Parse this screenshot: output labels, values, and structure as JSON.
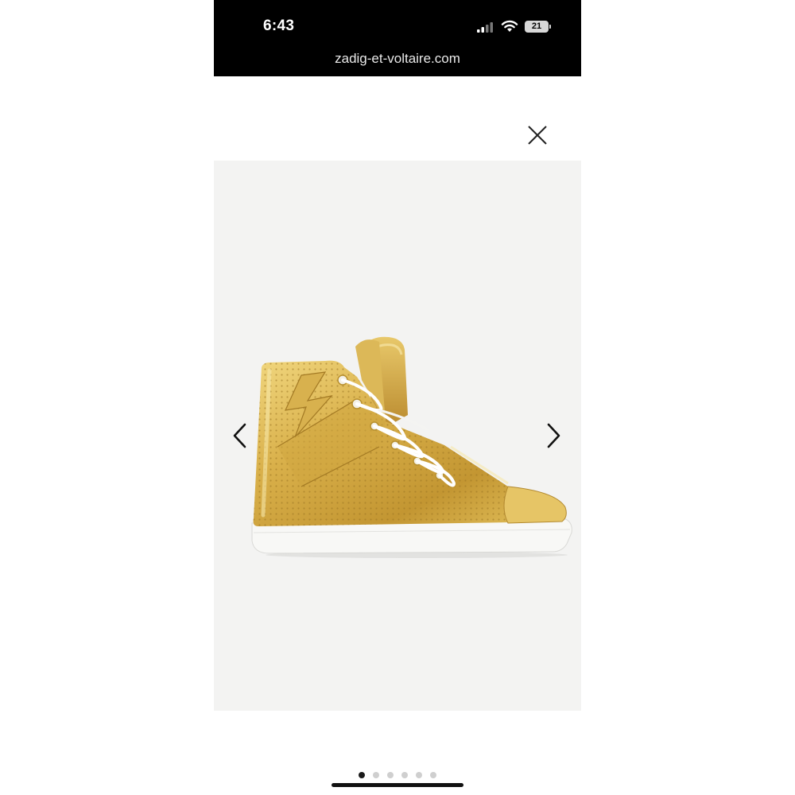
{
  "status_bar": {
    "time": "6:43",
    "battery_level": "21",
    "signal_icon": "cellular-signal-icon",
    "wifi_icon": "wifi-icon",
    "battery_icon": "battery-icon"
  },
  "browser": {
    "url": "zadig-et-voltaire.com"
  },
  "viewer": {
    "close_icon": "close-icon",
    "prev_icon": "chevron-left-icon",
    "next_icon": "chevron-right-icon",
    "image_count": 6,
    "active_index": 0
  },
  "colors": {
    "gallery_background": "#f3f3f2",
    "sneaker_gold": "#d4ae4a",
    "sole_white": "#f7f7f5"
  }
}
